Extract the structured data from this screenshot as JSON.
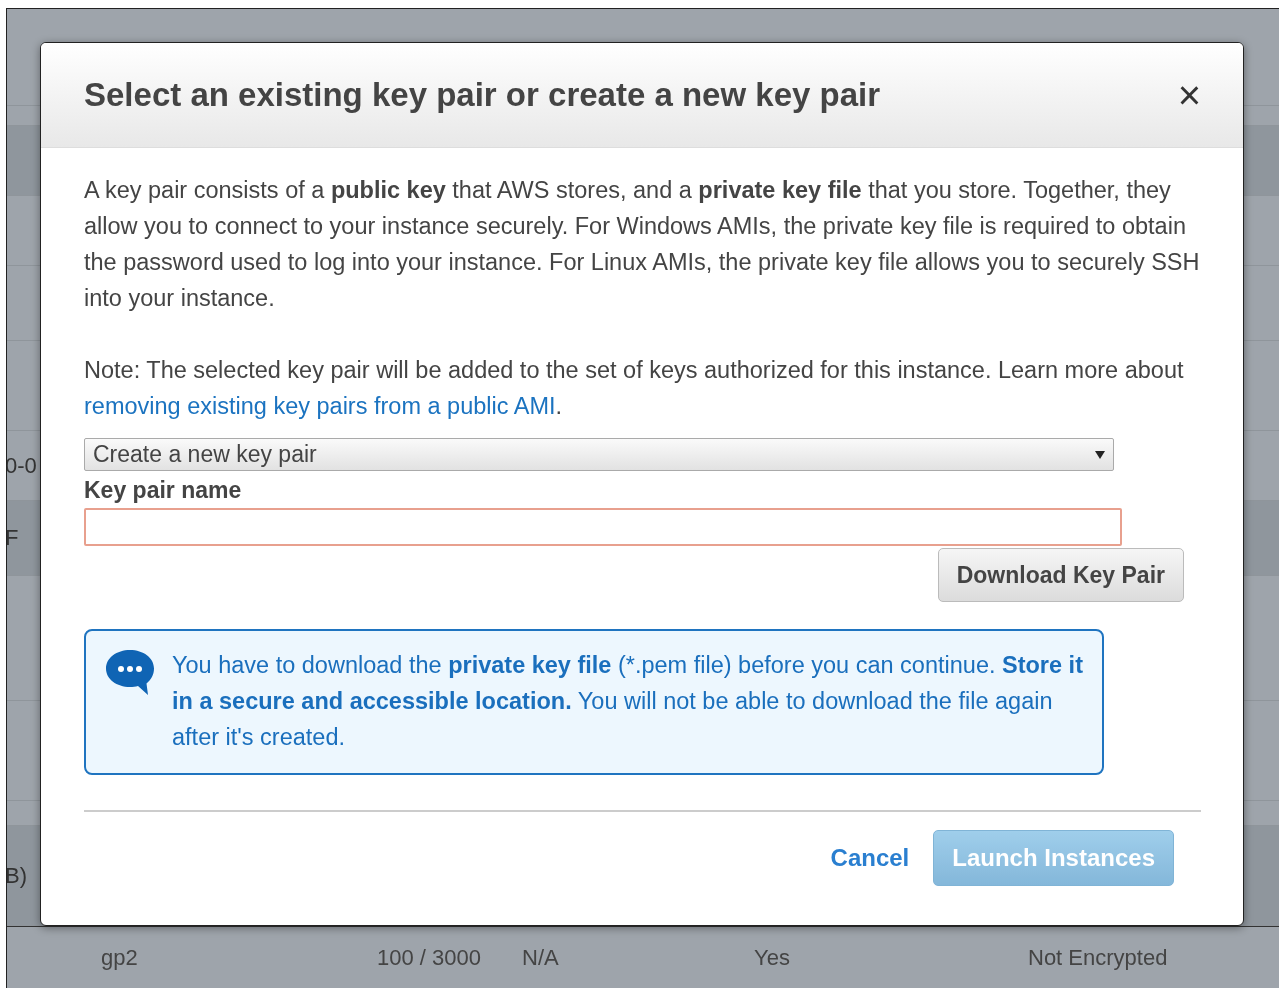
{
  "background": {
    "fragments": [
      "0-0",
      "F",
      "B)"
    ],
    "bottom_row": [
      "gp2",
      "100 / 3000",
      "N/A",
      "Yes",
      "Not Encrypted"
    ]
  },
  "dialog": {
    "title": "Select an existing key pair or create a new key pair",
    "close": "×",
    "intro": "A key pair consists of a **public key** that AWS stores, and a **private key file** that you store. Together, they allow you to connect to your instance securely. For Windows AMIs, the private key file is required to obtain the password used to log into your instance. For Linux AMIs, the private key file allows you to securely SSH into your instance.",
    "note": {
      "text": "Note: The selected key pair will be added to the set of keys authorized for this instance. Learn more about",
      "link": "removing existing key pairs from a public AMI",
      "after": "."
    },
    "key_pair_select": {
      "value": "Create a new key pair"
    },
    "name_label": "Key pair name",
    "name_field": {
      "focused": true
    },
    "download_button": "Download Key Pair",
    "info": "You have to download the **private key file** (*.pem file) before you can continue. **Store it in a secure and accessible location.** You will not be able to download the file again after it's created.",
    "cancel": "Cancel",
    "launch": {
      "label": "Launch Instances",
      "disabled": true
    }
  }
}
